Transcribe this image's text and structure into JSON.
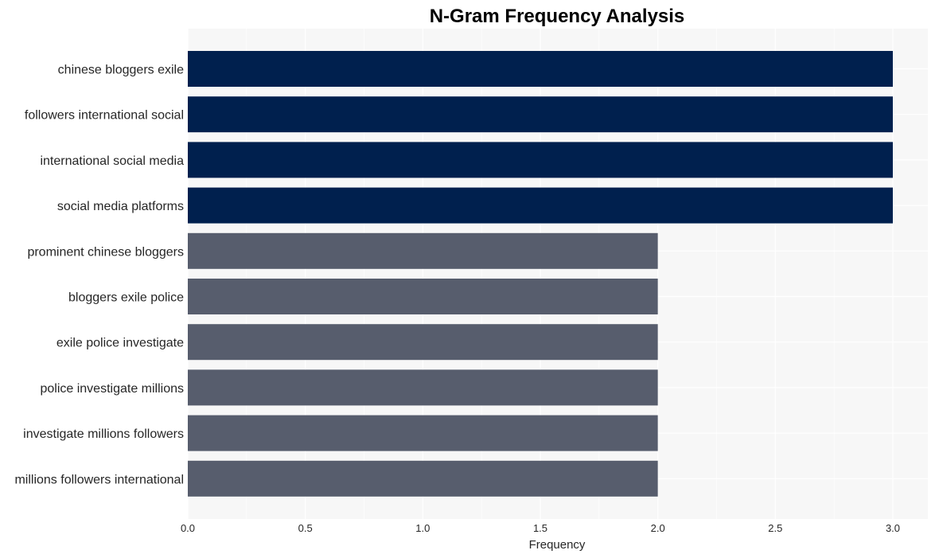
{
  "chart_data": {
    "type": "bar",
    "orientation": "horizontal",
    "title": "N-Gram Frequency Analysis",
    "xlabel": "Frequency",
    "ylabel": "",
    "xlim": [
      0,
      3.15
    ],
    "xticks": [
      "0.0",
      "0.5",
      "1.0",
      "1.5",
      "2.0",
      "2.5",
      "3.0"
    ],
    "xtick_values": [
      0,
      0.5,
      1.0,
      1.5,
      2.0,
      2.5,
      3.0
    ],
    "grid": true,
    "legend": "none",
    "categories": [
      "chinese bloggers exile",
      "followers international social",
      "international social media",
      "social media platforms",
      "prominent chinese bloggers",
      "bloggers exile police",
      "exile police investigate",
      "police investigate millions",
      "investigate millions followers",
      "millions followers international"
    ],
    "values": [
      3,
      3,
      3,
      3,
      2,
      2,
      2,
      2,
      2,
      2
    ],
    "colors": {
      "top": "#00204e",
      "other": "#575d6d",
      "plot_background": "#f7f7f7",
      "grid": "#ffffff"
    }
  }
}
